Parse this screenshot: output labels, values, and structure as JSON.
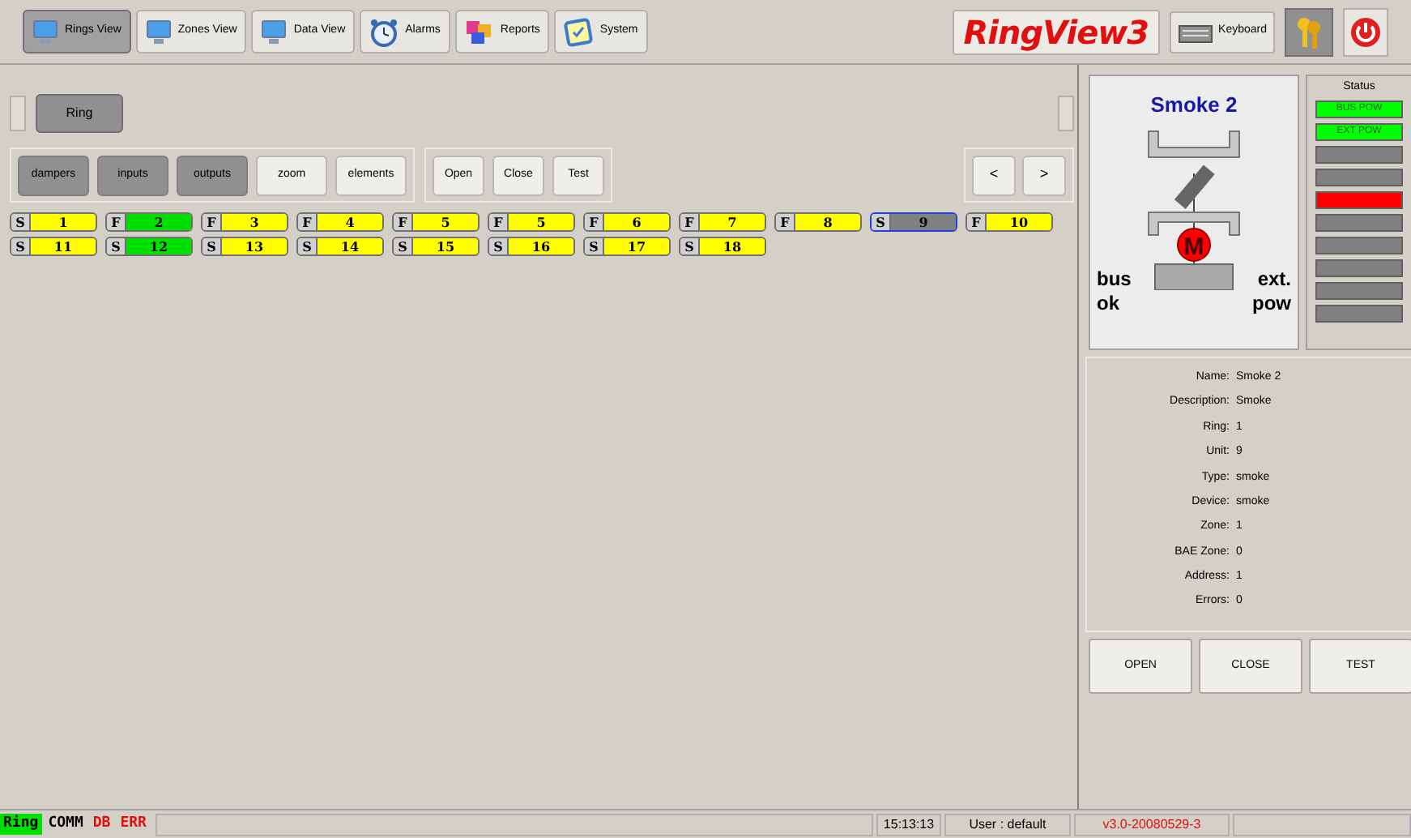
{
  "toolbar": {
    "tabs": [
      {
        "label": "Rings View",
        "selected": true,
        "kind": "view"
      },
      {
        "label": "Zones View",
        "selected": false,
        "kind": "view"
      },
      {
        "label": "Data View",
        "selected": false,
        "kind": "view"
      },
      {
        "label": "Alarms",
        "selected": false,
        "kind": "alarms"
      },
      {
        "label": "Reports",
        "selected": false,
        "kind": "reports"
      },
      {
        "label": "System",
        "selected": false,
        "kind": "system"
      }
    ],
    "logo": "RingView3",
    "keyboard": "Keyboard"
  },
  "ring_tab": {
    "label": "Ring"
  },
  "filters": [
    {
      "label": "dampers",
      "selected": true
    },
    {
      "label": "inputs",
      "selected": true
    },
    {
      "label": "outputs",
      "selected": true
    },
    {
      "label": "zoom",
      "selected": false
    },
    {
      "label": "elements",
      "selected": false
    }
  ],
  "actions": [
    "Open",
    "Close",
    "Test"
  ],
  "nav": [
    "<",
    ">"
  ],
  "units": [
    {
      "type": "S",
      "number": "1",
      "color": "#ffff00",
      "selected": false
    },
    {
      "type": "F",
      "number": "2",
      "color": "#00e000",
      "selected": false
    },
    {
      "type": "F",
      "number": "3",
      "color": "#ffff00",
      "selected": false
    },
    {
      "type": "F",
      "number": "4",
      "color": "#ffff00",
      "selected": false
    },
    {
      "type": "F",
      "number": "5",
      "color": "#ffff00",
      "selected": false
    },
    {
      "type": "F",
      "number": "5",
      "color": "#ffff00",
      "selected": false
    },
    {
      "type": "F",
      "number": "6",
      "color": "#ffff00",
      "selected": false
    },
    {
      "type": "F",
      "number": "7",
      "color": "#ffff00",
      "selected": false
    },
    {
      "type": "F",
      "number": "8",
      "color": "#ffff00",
      "selected": false
    },
    {
      "type": "S",
      "number": "9",
      "color": "#808080",
      "selected": true
    },
    {
      "type": "F",
      "number": "10",
      "color": "#ffff00",
      "selected": false
    },
    {
      "type": "S",
      "number": "11",
      "color": "#ffff00",
      "selected": false
    },
    {
      "type": "S",
      "number": "12",
      "color": "#00e000",
      "selected": false
    },
    {
      "type": "S",
      "number": "13",
      "color": "#ffff00",
      "selected": false
    },
    {
      "type": "S",
      "number": "14",
      "color": "#ffff00",
      "selected": false
    },
    {
      "type": "S",
      "number": "15",
      "color": "#ffff00",
      "selected": false
    },
    {
      "type": "S",
      "number": "16",
      "color": "#ffff00",
      "selected": false
    },
    {
      "type": "S",
      "number": "17",
      "color": "#ffff00",
      "selected": false
    },
    {
      "type": "S",
      "number": "18",
      "color": "#ffff00",
      "selected": false
    }
  ],
  "device": {
    "title": "Smoke 2",
    "motor": "M",
    "left_label": [
      "bus",
      "ok"
    ],
    "right_label": [
      "ext.",
      "pow"
    ]
  },
  "status": {
    "title": "Status",
    "lamps": [
      {
        "label": "BUS POW",
        "color": "#00ff00"
      },
      {
        "label": "EXT POW",
        "color": "#00ff00"
      },
      {
        "color": "#808080"
      },
      {
        "color": "#808080"
      },
      {
        "color": "#ff0000"
      },
      {
        "color": "#808080"
      },
      {
        "color": "#808080"
      },
      {
        "color": "#808080"
      },
      {
        "color": "#808080"
      },
      {
        "color": "#808080"
      }
    ]
  },
  "details": [
    {
      "label": "Name:",
      "value": "Smoke 2"
    },
    {
      "label": "Description:",
      "value": "Smoke"
    },
    {
      "label": "Ring:",
      "value": "1"
    },
    {
      "label": "Unit:",
      "value": "9"
    },
    {
      "label": "Type:",
      "value": "smoke"
    },
    {
      "label": "Device:",
      "value": "smoke"
    },
    {
      "label": "Zone:",
      "value": "1"
    },
    {
      "label": "BAE Zone:",
      "value": "0"
    },
    {
      "label": "Address:",
      "value": "1"
    },
    {
      "label": "Errors:",
      "value": "0"
    }
  ],
  "commands": [
    "OPEN",
    "CLOSE",
    "TEST"
  ],
  "status_bar": {
    "indicators": [
      {
        "label": "Ring",
        "kind": "ok"
      },
      {
        "label": "COMM",
        "kind": "neutral"
      },
      {
        "label": "DB",
        "kind": "error"
      },
      {
        "label": "ERR",
        "kind": "error"
      }
    ],
    "time": "15:13:13",
    "user": "User : default",
    "version": "v3.0-20080529-3"
  }
}
